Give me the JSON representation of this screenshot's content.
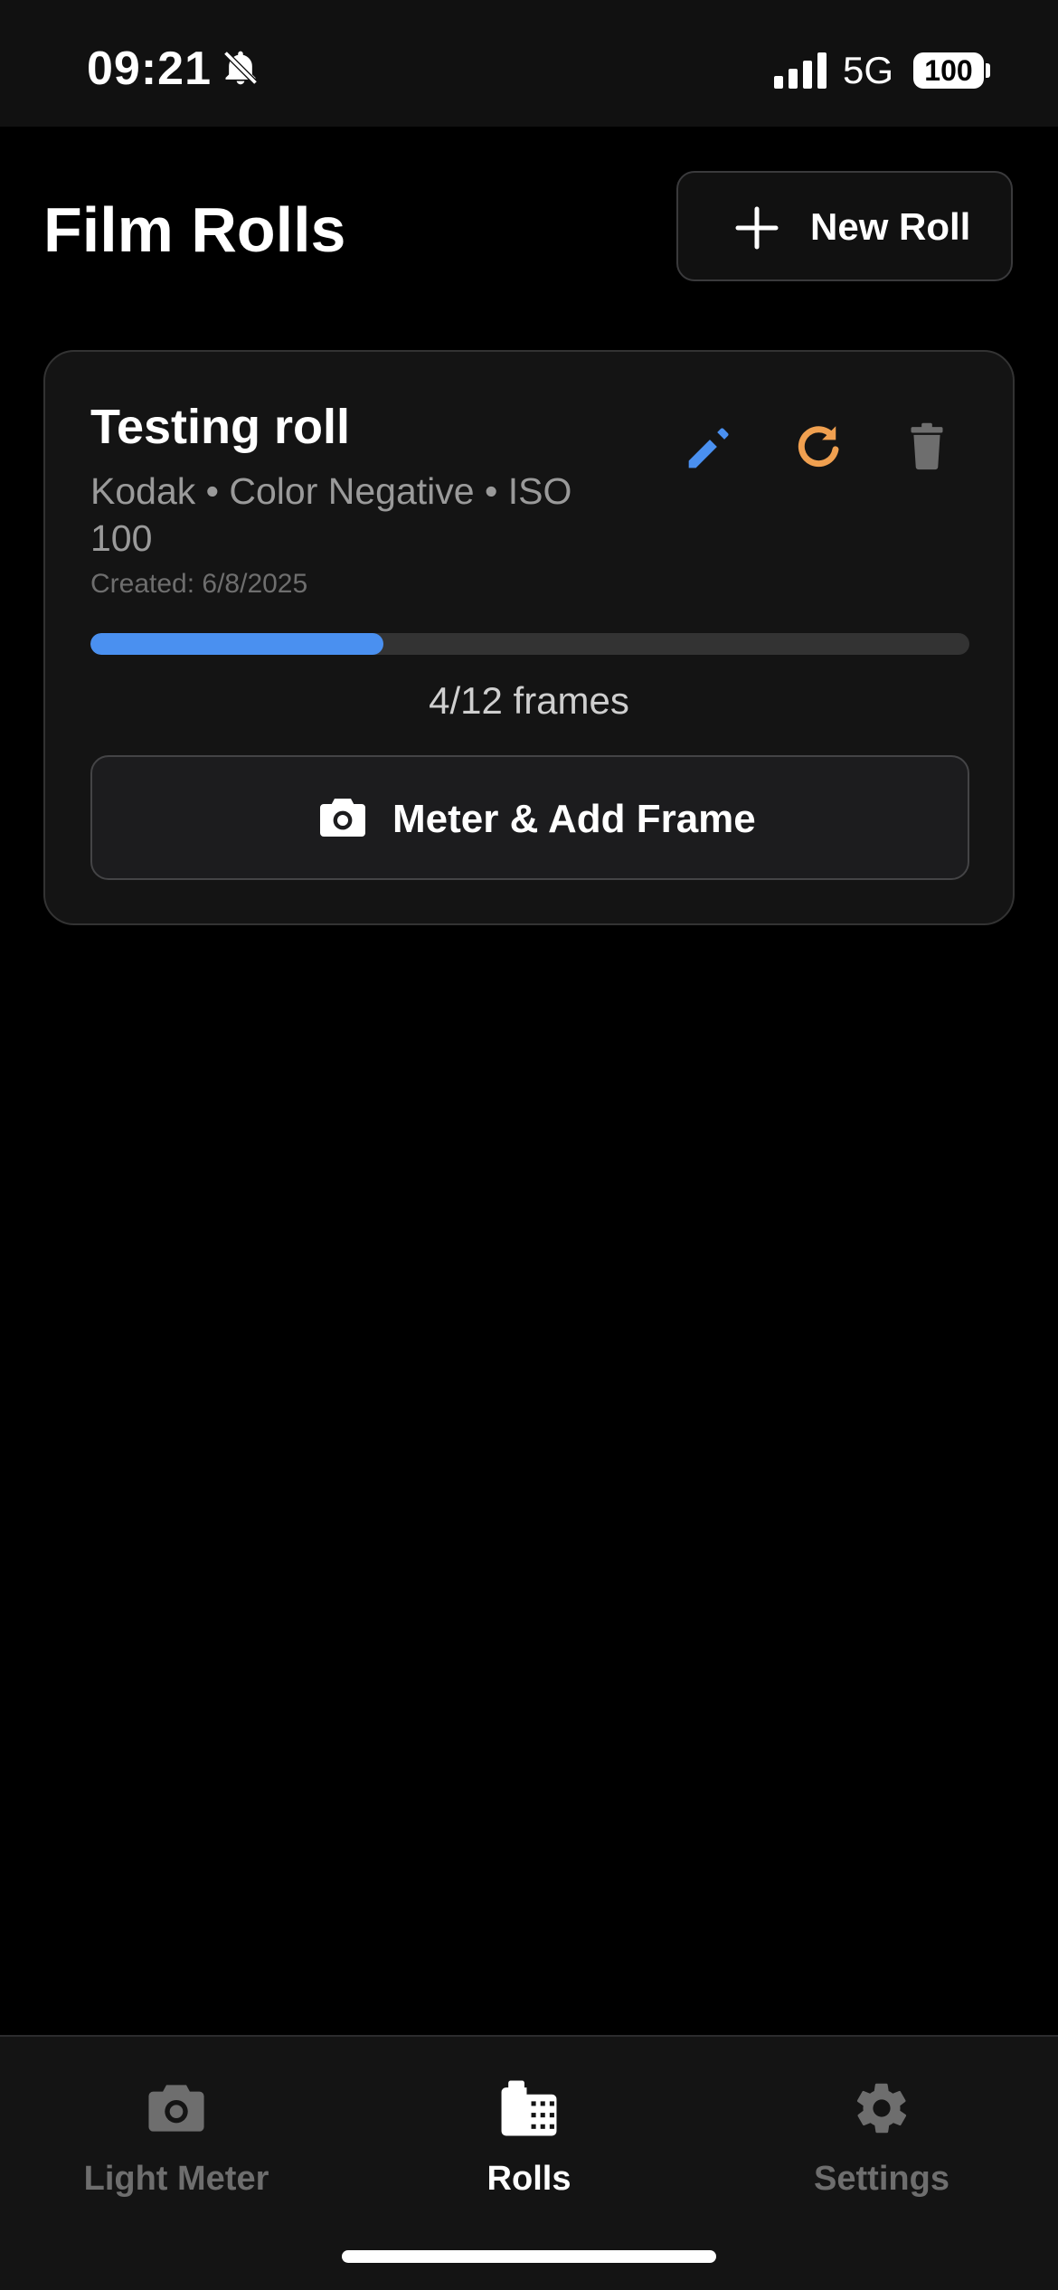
{
  "status_bar": {
    "time": "09:21",
    "network": "5G",
    "battery": "100",
    "icons": [
      "bell-slash-icon",
      "signal-icon",
      "battery-icon"
    ]
  },
  "header": {
    "title": "Film Rolls",
    "new_roll_label": "New Roll",
    "new_roll_icon": "plus-icon"
  },
  "rolls": [
    {
      "name": "Testing roll",
      "details": "Kodak • Color Negative • ISO 100",
      "created": "Created: 6/8/2025",
      "frames_used": 4,
      "frames_total": 12,
      "progress_fraction": 0.333,
      "progress_label": "4/12 frames",
      "action_label": "Meter & Add Frame",
      "action_icon": "camera-icon",
      "icons": {
        "edit": "pencil-icon",
        "reset": "refresh-icon",
        "delete": "trash-icon"
      }
    }
  ],
  "tab_bar": {
    "tabs": [
      {
        "label": "Light Meter",
        "icon": "camera-icon",
        "active": false
      },
      {
        "label": "Rolls",
        "icon": "film-icon",
        "active": true
      },
      {
        "label": "Settings",
        "icon": "gear-icon",
        "active": false
      }
    ]
  },
  "colors": {
    "background": "#000000",
    "surface": "#141414",
    "accent_blue": "#4a90f0",
    "accent_orange": "#f0a050",
    "inactive_gray": "#6e6e6e"
  }
}
